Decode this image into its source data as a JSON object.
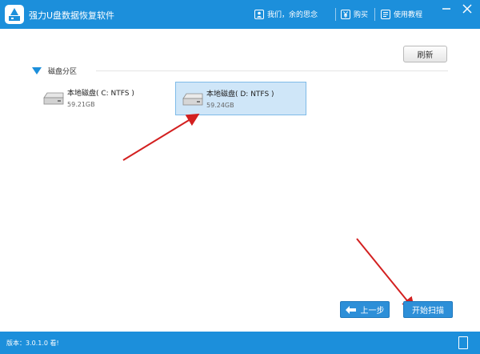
{
  "window": {
    "title": "强力U盘数据恢复软件"
  },
  "header_links": [
    {
      "label": "我们，余的思念",
      "icon": "user-icon"
    },
    {
      "label": "购买",
      "icon": "yen-icon"
    },
    {
      "label": "使用教程",
      "icon": "book-icon"
    }
  ],
  "toolbar": {
    "refresh_label": "刷新"
  },
  "section": {
    "label": "磁盘分区"
  },
  "drives": [
    {
      "name": "本地磁盘( C: NTFS )",
      "size": "59.21GB",
      "selected": false
    },
    {
      "name": "本地磁盘( D: NTFS )",
      "size": "59.24GB",
      "selected": true
    }
  ],
  "actions": {
    "back_label": "上一步",
    "start_label": "开始扫描"
  },
  "status": {
    "version": "版本：3.0.1.0 看!"
  },
  "colors": {
    "brand": "#1c8fdb",
    "selected_bg": "#cfe6f8",
    "arrow": "#d32020"
  }
}
